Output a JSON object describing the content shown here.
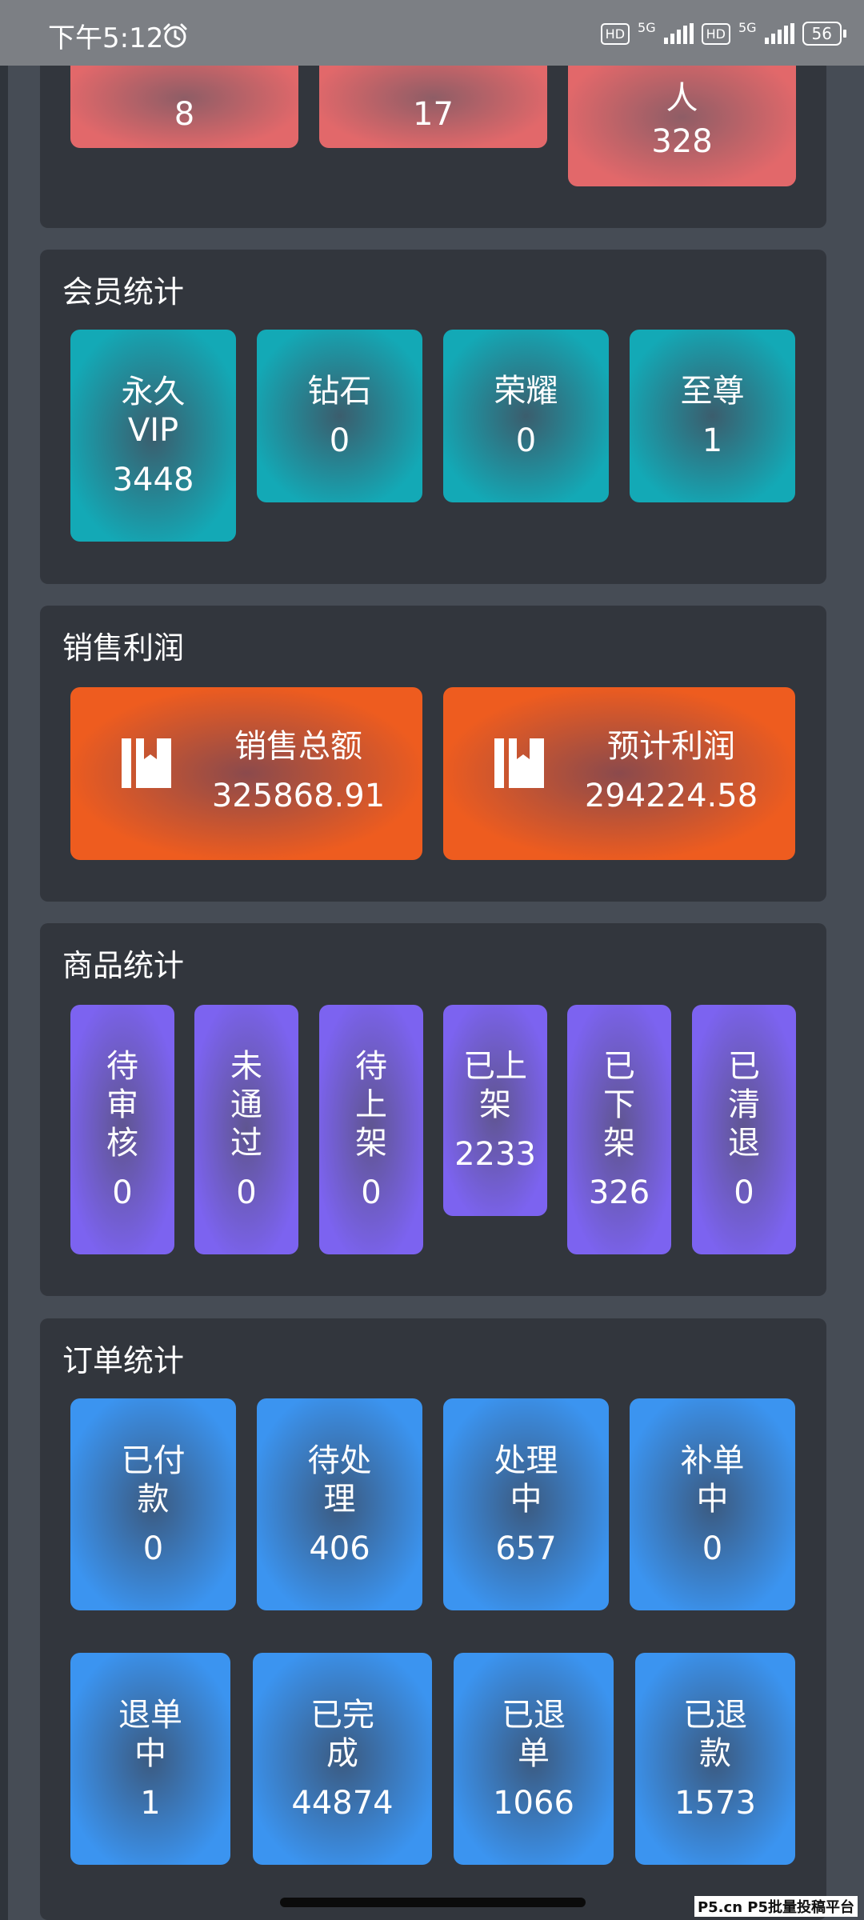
{
  "status_bar": {
    "time": "下午5:12",
    "hd1": "HD",
    "net1": "5G",
    "hd2": "HD",
    "net2": "5G",
    "battery": "56"
  },
  "top_panel": {
    "cards": [
      {
        "label": "",
        "value": "8"
      },
      {
        "label": "",
        "value": "17"
      },
      {
        "label": "人",
        "value": "328"
      }
    ]
  },
  "member_stats": {
    "title": "会员统计",
    "cards": [
      {
        "label": "永久\nVIP",
        "value": "3448"
      },
      {
        "label": "钻石",
        "value": "0"
      },
      {
        "label": "荣耀",
        "value": "0"
      },
      {
        "label": "至尊",
        "value": "1"
      }
    ]
  },
  "sales_profit": {
    "title": "销售利润",
    "cards": [
      {
        "label": "销售总额",
        "value": "325868.91",
        "icon": "book-icon"
      },
      {
        "label": "预计利润",
        "value": "294224.58",
        "icon": "book-icon"
      }
    ]
  },
  "product_stats": {
    "title": "商品统计",
    "cards": [
      {
        "label": "待\n审\n核",
        "value": "0"
      },
      {
        "label": "未\n通\n过",
        "value": "0"
      },
      {
        "label": "待\n上\n架",
        "value": "0"
      },
      {
        "label": "已上\n架",
        "value": "2233"
      },
      {
        "label": "已\n下\n架",
        "value": "326"
      },
      {
        "label": "已\n清\n退",
        "value": "0"
      }
    ]
  },
  "order_stats": {
    "title": "订单统计",
    "row1": [
      {
        "label": "已付\n款",
        "value": "0"
      },
      {
        "label": "待处\n理",
        "value": "406"
      },
      {
        "label": "处理\n中",
        "value": "657"
      },
      {
        "label": "补单\n中",
        "value": "0"
      }
    ],
    "row2": [
      {
        "label": "退单\n中",
        "value": "1"
      },
      {
        "label": "已完\n成",
        "value": "44874"
      },
      {
        "label": "已退\n单",
        "value": "1066"
      },
      {
        "label": "已退\n款",
        "value": "1573"
      }
    ]
  },
  "watermark": "P5.cn P5批量投稿平台",
  "colors": {
    "red": "#e2686a",
    "teal": "#13a9b6",
    "orange": "#ee5c1f",
    "purple": "#7c63f0",
    "blue": "#3b94f0",
    "panel": "#32363d",
    "background": "#464c55"
  }
}
